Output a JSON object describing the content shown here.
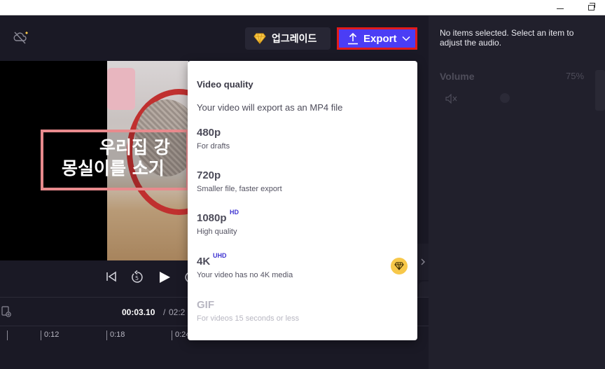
{
  "window": {
    "minimize_glyph": "—",
    "restore_glyph": "❐"
  },
  "topbar": {
    "upgrade_label": "업그레이드",
    "export_label": "Export"
  },
  "sidebar": {
    "message": "No items selected. Select an item to adjust the audio.",
    "volume_label": "Volume",
    "volume_value": "75%"
  },
  "preview": {
    "caption_line1": "우리집 강",
    "caption_line2": "몽실이를 소기"
  },
  "timeline": {
    "current_time": "00:03.10",
    "separator": "/",
    "total_time": "02:2",
    "ticks": [
      "0:12",
      "0:18",
      "0:24"
    ]
  },
  "export_menu": {
    "title": "Video quality",
    "subtitle": "Your video will export as an MP4 file",
    "options": [
      {
        "name": "480p",
        "badge": "",
        "desc": "For drafts",
        "enabled": true
      },
      {
        "name": "720p",
        "badge": "",
        "desc": "Smaller file, faster export",
        "enabled": true
      },
      {
        "name": "1080p",
        "badge": "HD",
        "desc": "High quality",
        "enabled": true
      },
      {
        "name": "4K",
        "badge": "UHD",
        "desc": "Your video has no 4K media",
        "enabled": true,
        "premium": true
      },
      {
        "name": "GIF",
        "badge": "",
        "desc": "For videos 15 seconds or less",
        "enabled": false
      }
    ]
  },
  "colors": {
    "accent": "#4b3df5",
    "highlight_border": "#e21b1b",
    "premium": "#f7c84a",
    "background": "#1a1925"
  }
}
